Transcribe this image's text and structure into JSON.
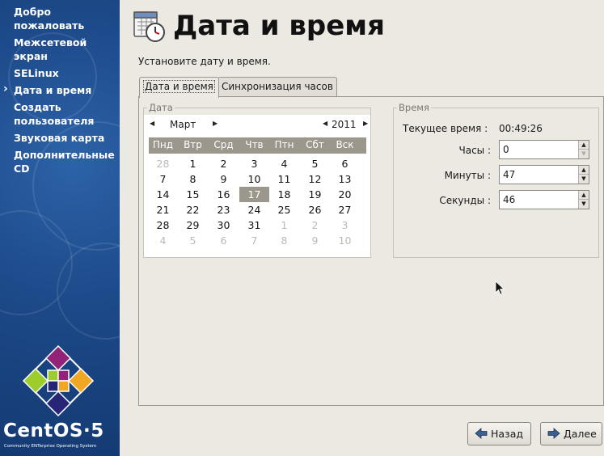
{
  "sidebar": {
    "items": [
      {
        "label": "Добро пожаловать"
      },
      {
        "label": "Межсетевой экран"
      },
      {
        "label": "SELinux"
      },
      {
        "label": "Дата и время"
      },
      {
        "label": "Создать пользователя"
      },
      {
        "label": "Звуковая карта"
      },
      {
        "label": "Дополнительные CD"
      }
    ],
    "active_index": 3,
    "brand": "CentOS·5",
    "brand_sub": "Community ENTerprise Operating System"
  },
  "header": {
    "title": "Дата и время",
    "icon": "calendar-clock-icon"
  },
  "instruction": "Установите дату и время.",
  "tabs": [
    {
      "label": "Дата и время",
      "active": true
    },
    {
      "label": "Синхронизация часов",
      "active": false
    }
  ],
  "date_group": {
    "legend": "Дата",
    "month": "Март",
    "year": "2011",
    "weekdays": [
      "Пнд",
      "Втр",
      "Срд",
      "Чтв",
      "Птн",
      "Сбт",
      "Вск"
    ],
    "weeks": [
      [
        "28",
        "1",
        "2",
        "3",
        "4",
        "5",
        "6"
      ],
      [
        "7",
        "8",
        "9",
        "10",
        "11",
        "12",
        "13"
      ],
      [
        "14",
        "15",
        "16",
        "17",
        "18",
        "19",
        "20"
      ],
      [
        "21",
        "22",
        "23",
        "24",
        "25",
        "26",
        "27"
      ],
      [
        "28",
        "29",
        "30",
        "31",
        "1",
        "2",
        "3"
      ],
      [
        "4",
        "5",
        "6",
        "7",
        "8",
        "9",
        "10"
      ]
    ],
    "selected_day": "17"
  },
  "time_group": {
    "legend": "Время",
    "current_label": "Текущее время :",
    "current_value": "00:49:26",
    "hours_label": "Часы :",
    "hours_value": "0",
    "minutes_label": "Минуты :",
    "minutes_value": "47",
    "seconds_label": "Секунды :",
    "seconds_value": "46"
  },
  "footer": {
    "back_label": "Назад",
    "next_label": "Далее"
  },
  "colors": {
    "sidebar_bg": "#1d4a8a",
    "window_bg": "#ece8e2",
    "calendar_header_bg": "#9c978d"
  }
}
